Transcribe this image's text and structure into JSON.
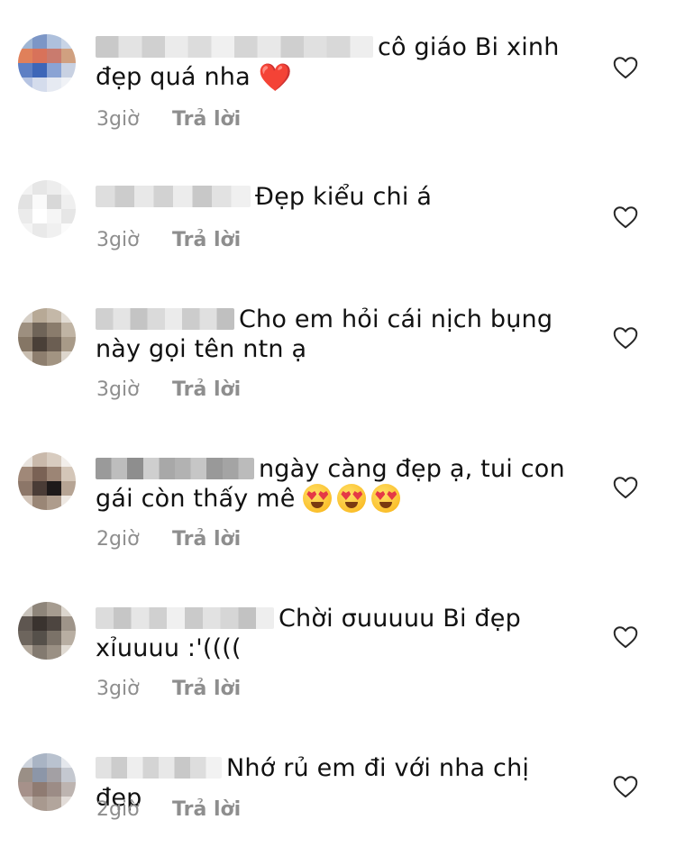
{
  "comments": [
    {
      "text": "cô giáo Bi xinh đẹp quá nha ",
      "emoji": "❤️",
      "time": "3giờ",
      "reply": "Trả lời",
      "avatar": [
        "#9fb6d4",
        "#7c96c6",
        "#aec0dc",
        "#c8d4e6",
        "#e0805a",
        "#d8725a",
        "#c97b6e",
        "#d0a080",
        "#5d7fc4",
        "#3d66b8",
        "#8aa3d4",
        "#c8d1e2",
        "#b6c4e2",
        "#d4dcec",
        "#e6eaf2",
        "#f0f2f6"
      ],
      "username_blocks": [
        "#c9c9c9",
        "#e3e3e3",
        "#d0d0d0",
        "#ebebeb",
        "#dcdcdc",
        "#f0f0f0",
        "#d5d5d5",
        "#e8e8e8",
        "#cfcfcf",
        "#e0e0e0",
        "#d8d8d8",
        "#eeeeee"
      ]
    },
    {
      "text": "Đẹp kiểu chi á",
      "emoji": "",
      "time": "3giờ",
      "reply": "Trả lời",
      "avatar": [
        "#f2f2f2",
        "#e6e6e6",
        "#ededed",
        "#f6f6f6",
        "#e2e2e2",
        "#fafafa",
        "#d8d8d8",
        "#efefef",
        "#ebebeb",
        "#ffffff",
        "#f5f5f5",
        "#e6e6e6",
        "#f4f4f4",
        "#e9e9e9",
        "#f0f0f0",
        "#fbfbfb"
      ],
      "username_blocks": [
        "#dedede",
        "#cccccc",
        "#e8e8e8",
        "#d2d2d2",
        "#ececec",
        "#c8c8c8",
        "#e2e2e2",
        "#f0f0f0"
      ]
    },
    {
      "text": "Cho em hỏi cái nịch bụng này gọi tên ntn ạ",
      "emoji": "",
      "time": "3giờ",
      "reply": "Trả lời",
      "avatar": [
        "#d6cfc6",
        "#b7a996",
        "#c4b8a8",
        "#e2dcd4",
        "#9d8f7f",
        "#6f6458",
        "#8a7c6c",
        "#c0b4a4",
        "#857665",
        "#4a4038",
        "#6b5e52",
        "#a89a88",
        "#c9beb0",
        "#8d7e6e",
        "#a29482",
        "#ddd6cc"
      ],
      "username_blocks": [
        "#d0d0d0",
        "#e4e4e4",
        "#c4c4c4",
        "#dadada",
        "#ebebeb",
        "#cccccc",
        "#e0e0e0",
        "#c0c0c0"
      ]
    },
    {
      "text": "ngày càng đẹp ạ, tui con gái còn thấy mê ",
      "emoji": "😍😍😍",
      "time": "2giờ",
      "reply": "Trả lời",
      "avatar": [
        "#e8e2dc",
        "#c9b9ab",
        "#d8ccc0",
        "#f2eeea",
        "#a08878",
        "#7a6255",
        "#9c8575",
        "#d4c6b8",
        "#8c7668",
        "#4a3c36",
        "#1e1a1a",
        "#b6a494",
        "#d2c4b8",
        "#9a8676",
        "#ae9c8c",
        "#eee8e2"
      ],
      "username_blocks": [
        "#9a9a9a",
        "#bdbdbd",
        "#8e8e8e",
        "#cfcfcf",
        "#a8a8a8",
        "#b2b2b2",
        "#c6c6c6",
        "#999999",
        "#a4a4a4",
        "#bbbbbb"
      ]
    },
    {
      "text": "Chời σuuuuu Bi đẹp xỉuuuu :'((((",
      "emoji": "",
      "time": "3giờ",
      "reply": "Trả lời",
      "avatar": [
        "#c8c2ba",
        "#8e857a",
        "#a69c90",
        "#dcd6ce",
        "#5e5650",
        "#3a332f",
        "#4d4540",
        "#9e9489",
        "#6d655d",
        "#55504a",
        "#7b7268",
        "#b8aea2",
        "#b2a89c",
        "#837a70",
        "#9a9084",
        "#e0dad2"
      ],
      "username_blocks": [
        "#dcdcdc",
        "#c6c6c6",
        "#e6e6e6",
        "#d0d0d0",
        "#f0f0f0",
        "#cacaca",
        "#e2e2e2",
        "#d6d6d6",
        "#c2c2c2",
        "#eeeeee"
      ]
    },
    {
      "text": "Nhớ rủ em đi với nha chị đẹp",
      "emoji": "",
      "time": "2giờ",
      "reply": "Trả lời",
      "avatar": [
        "#cdd3dc",
        "#a9b4c4",
        "#b9c2cf",
        "#e4e7ec",
        "#9a8f86",
        "#8c96a8",
        "#a3a0a4",
        "#c4c8d0",
        "#a6918a",
        "#8f7b72",
        "#9c8c86",
        "#bdb4b0",
        "#c7bdb6",
        "#a8998f",
        "#b2a59c",
        "#e2dcd8"
      ],
      "username_blocks": [
        "#e2e2e2",
        "#cccccc",
        "#eeeeee",
        "#d4d4d4",
        "#e8e8e8",
        "#c8c8c8",
        "#dddddd",
        "#f2f2f2"
      ]
    }
  ]
}
